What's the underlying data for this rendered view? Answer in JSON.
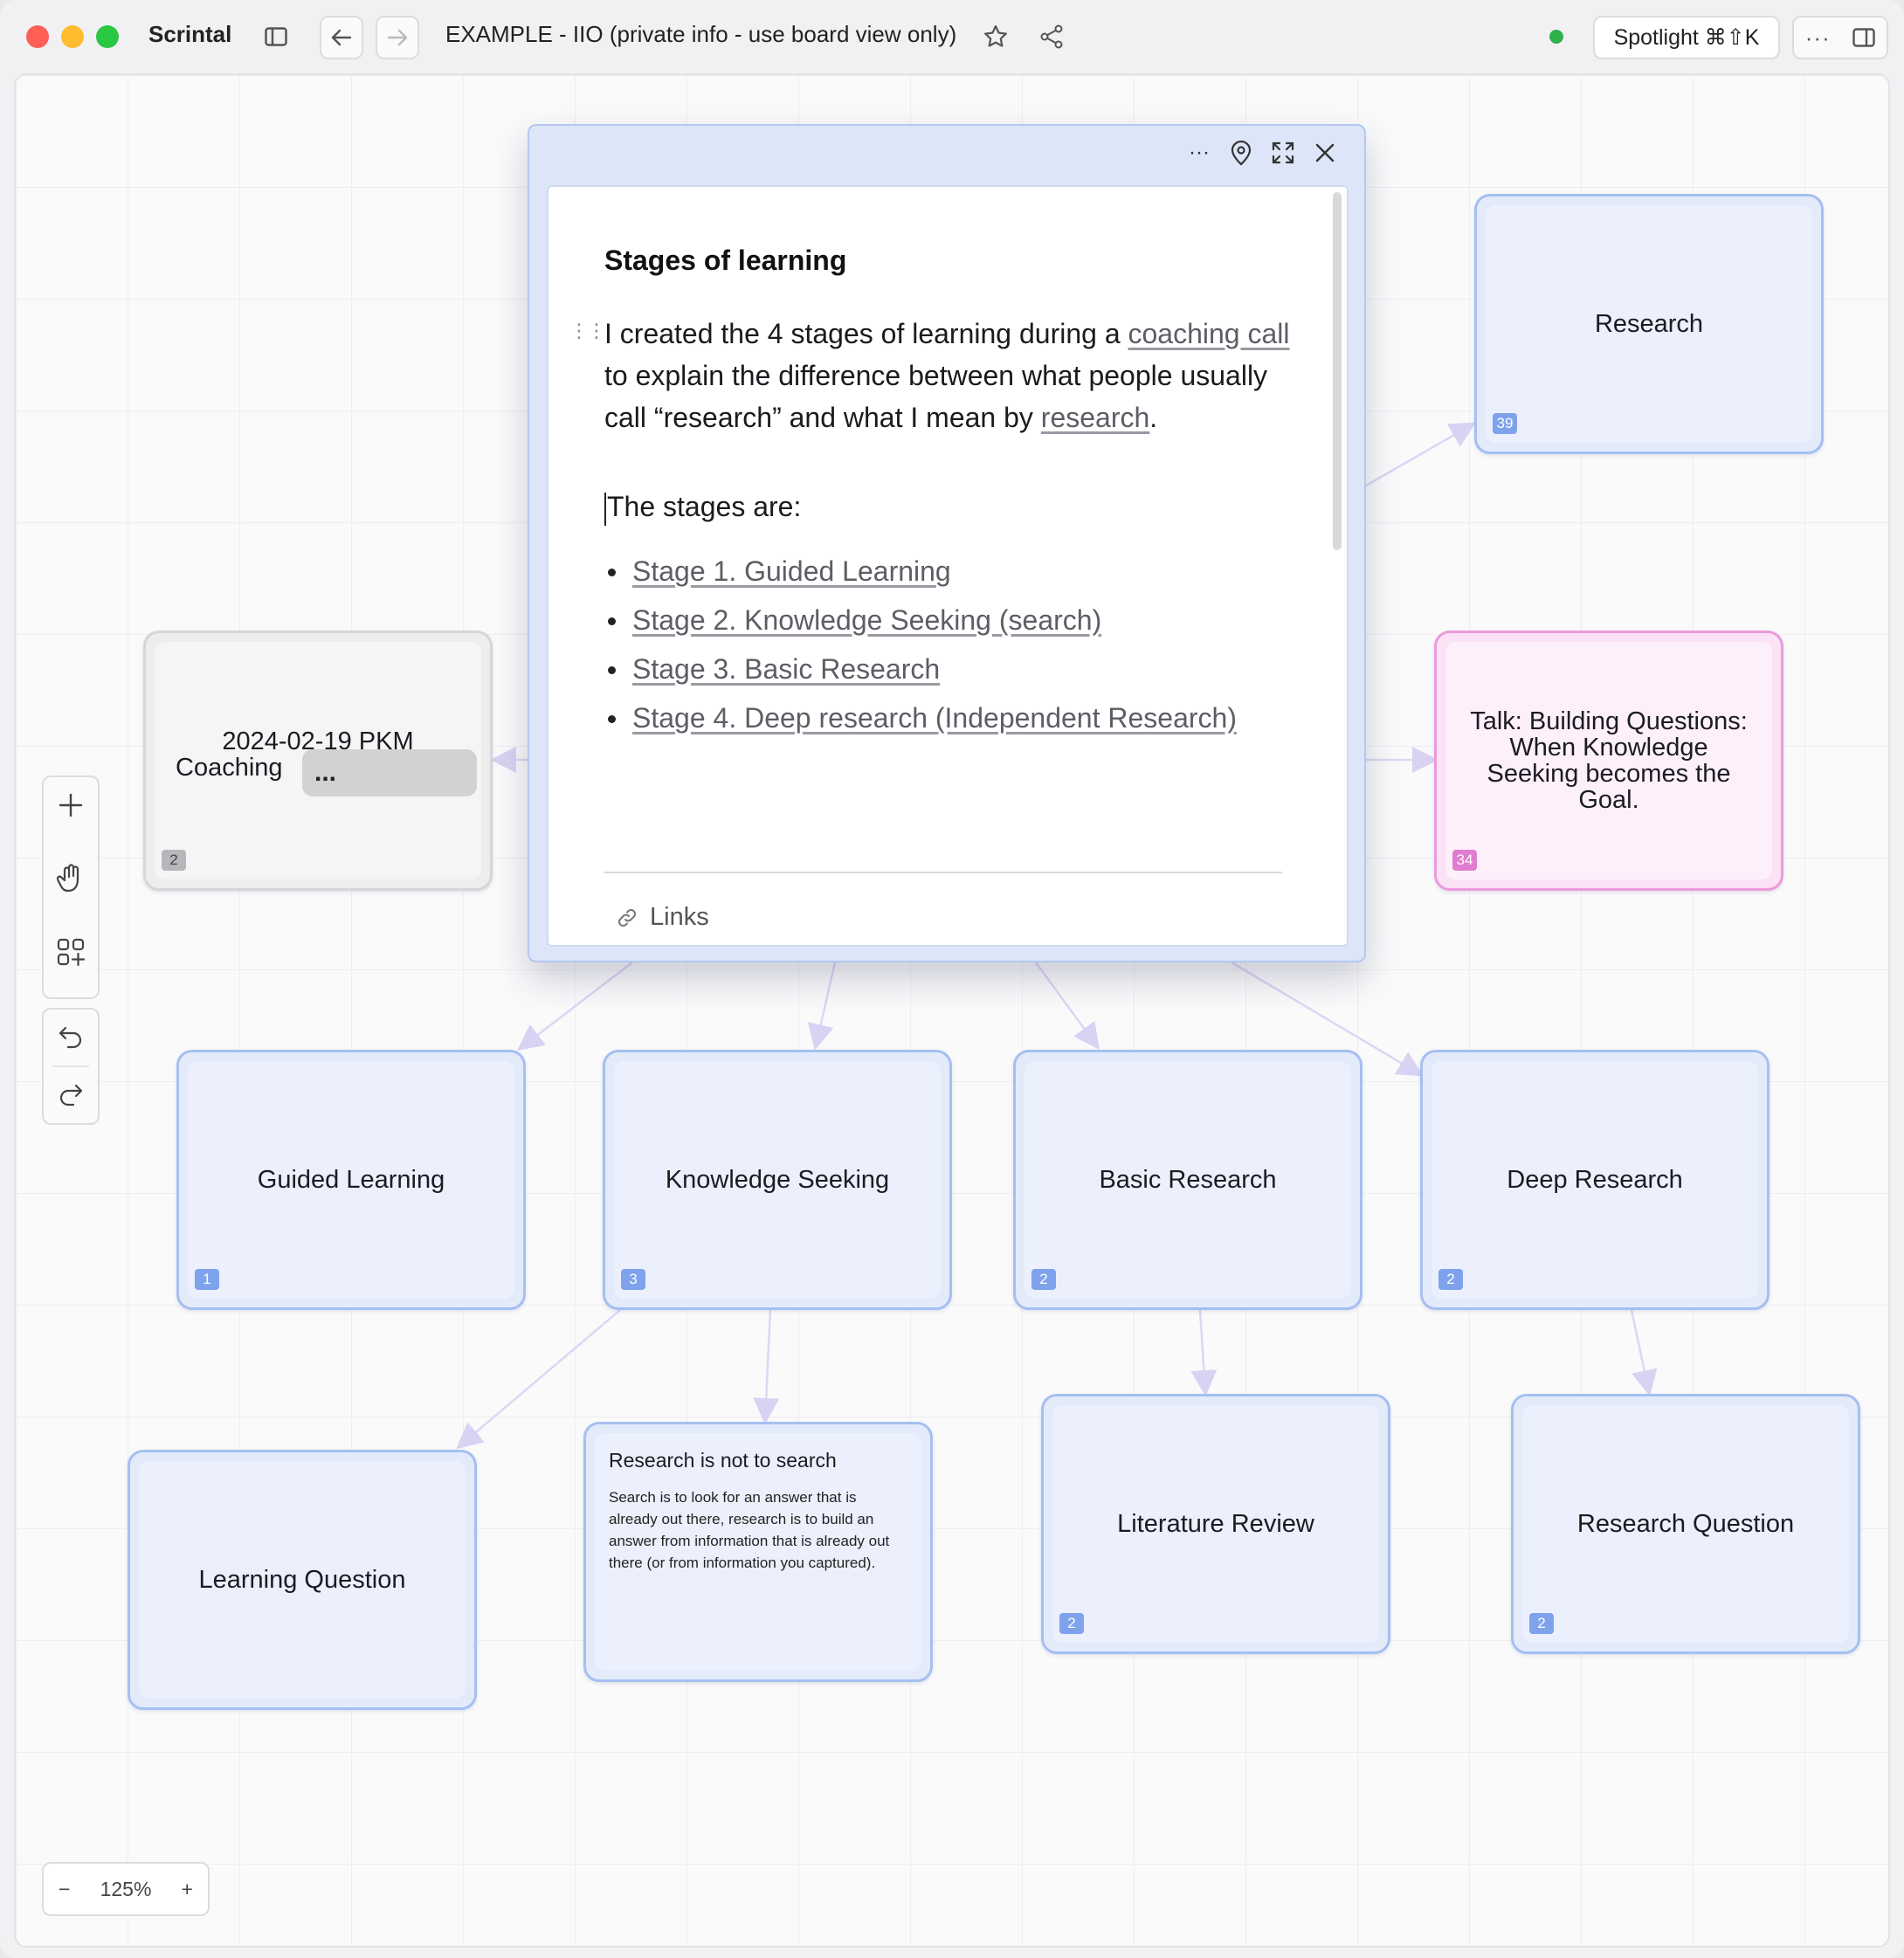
{
  "titlebar": {
    "app_name": "Scrintal",
    "document_title": "EXAMPLE - IIO (private info - use board view only)",
    "spotlight_label": "Spotlight ⌘⇧K"
  },
  "panel": {
    "heading": "Stages of learning",
    "intro_1": "I created the 4 stages of learning during a ",
    "intro_link_1": "coaching call",
    "intro_2": " to explain the difference between what people usually call “research” and what I mean by ",
    "intro_link_2": "research",
    "intro_3": ".",
    "stages_lead": "The stages are:",
    "stages": [
      "Stage 1. Guided Learning",
      "Stage 2. Knowledge Seeking (search)",
      "Stage 3. Basic Research",
      "Stage 4. Deep research (Independent Research)"
    ],
    "links_label": "Links"
  },
  "cards": {
    "research": {
      "label": "Research",
      "count": "39"
    },
    "coaching": {
      "label_line1": "2024-02-19 PKM",
      "label_line2": "Coaching",
      "chip": "...",
      "count": "2"
    },
    "talk": {
      "label": "Talk: Building Questions: When Knowledge Seeking becomes the Goal.",
      "count": "34"
    },
    "guided": {
      "label": "Guided Learning",
      "count": "1"
    },
    "knowledge": {
      "label": "Knowledge Seeking",
      "count": "3"
    },
    "basic": {
      "label": "Basic Research",
      "count": "2"
    },
    "deep": {
      "label": "Deep Research",
      "count": "2"
    },
    "learning_q": {
      "label": "Learning Question"
    },
    "not_search": {
      "title": "Research is not to search",
      "body": "Search is to look for an answer that is already out there, research is to build an answer from information that is already out there (or from information you captured)."
    },
    "lit_review": {
      "label": "Literature Review",
      "count": "2"
    },
    "research_q": {
      "label": "Research Question",
      "count": "2"
    }
  },
  "zoom": {
    "minus": "−",
    "level": "125%",
    "plus": "+"
  },
  "colors": {
    "accent_blue": "#a5bff0",
    "pink": "#ec9adc",
    "status_green": "#2fb24c"
  }
}
